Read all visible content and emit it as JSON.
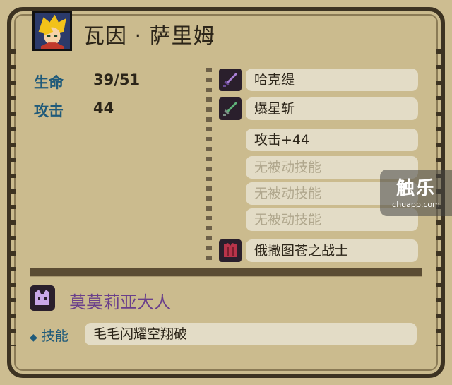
{
  "character": {
    "name": "瓦因 · 萨里姆",
    "portrait_icon": "hero-portrait-icon"
  },
  "stats": [
    {
      "label": "生命",
      "value": "39/51"
    },
    {
      "label": "攻击",
      "value": "44"
    }
  ],
  "equipment": {
    "weapon": {
      "icon": "sword-icon",
      "name": "哈克缇"
    },
    "weapon2": {
      "icon": "green-sword-icon",
      "name": "爆星斩"
    },
    "passives": [
      {
        "text": "攻击+44",
        "enabled": true
      },
      {
        "text": "无被动技能",
        "enabled": false
      },
      {
        "text": "无被动技能",
        "enabled": false
      },
      {
        "text": "无被动技能",
        "enabled": false
      }
    ],
    "class": {
      "icon": "armor-icon",
      "name": "俄撒图苍之战士"
    }
  },
  "spirit": {
    "icon": "cat-spirit-icon",
    "name": "莫莫莉亚大人"
  },
  "skill": {
    "label": "技能",
    "value": "毛毛闪耀空翔破"
  },
  "watermark": {
    "main": "触乐",
    "sub": "chuapp.com"
  },
  "colors": {
    "panel_bg": "#cbbb8e",
    "stat_label": "#1f5a7a",
    "spirit_name": "#6a3f8b",
    "slot_bg": "#e3dcc6"
  }
}
